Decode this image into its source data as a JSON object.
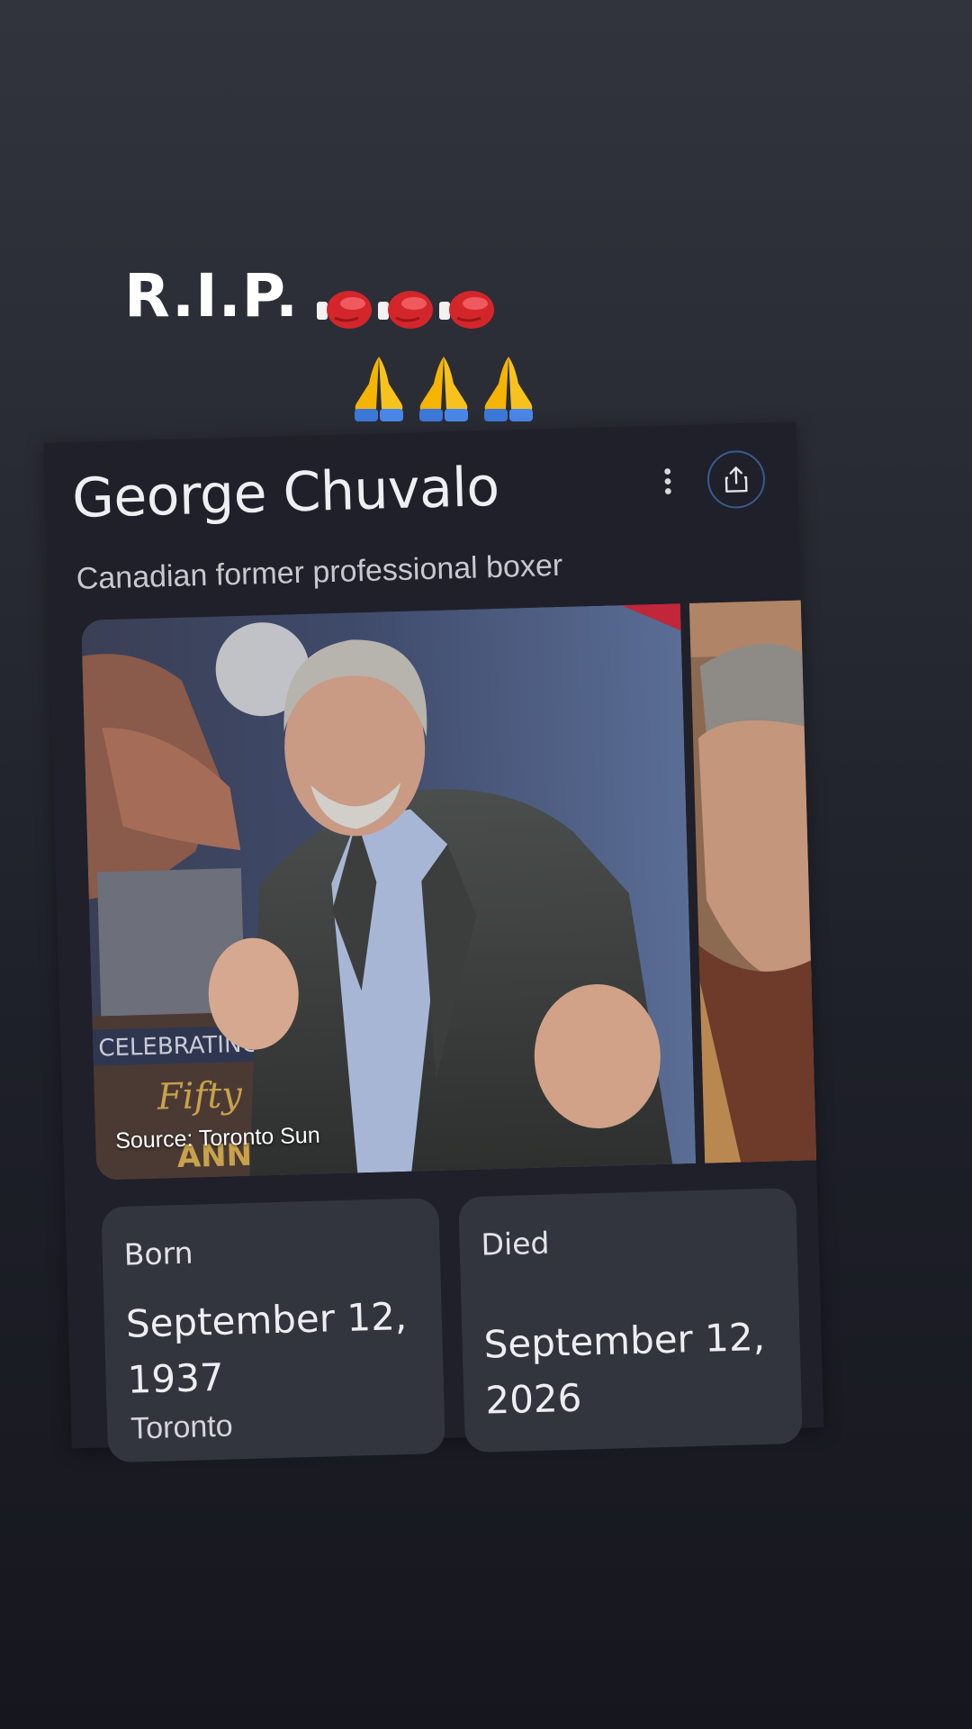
{
  "overlay": {
    "caption": "R.I.P.",
    "emoji_row1": [
      "boxing-glove",
      "boxing-glove",
      "boxing-glove"
    ],
    "emoji_row2": [
      "folded-hands",
      "folded-hands",
      "folded-hands"
    ]
  },
  "card": {
    "title": "George Chuvalo",
    "subtitle": "Canadian former professional boxer",
    "image_source": "Source: Toronto Sun",
    "icons": {
      "more": "more-vertical-icon",
      "share": "share-icon"
    },
    "born": {
      "label": "Born",
      "date": "September 12, 1937",
      "place": "Toronto"
    },
    "died": {
      "label": "Died",
      "date": "September 12, 2026"
    }
  },
  "colors": {
    "background_top": "#32343d",
    "background_bottom": "#16171e",
    "card_background": "#1f2029",
    "tile_background": "#32353e",
    "share_ring": "#3b5a8f",
    "glove_red": "#d3262b"
  }
}
